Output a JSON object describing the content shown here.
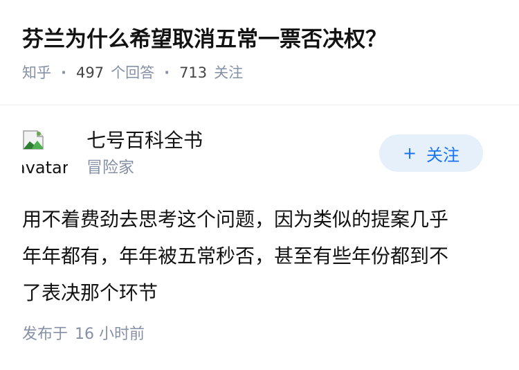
{
  "question": {
    "title": "芬兰为什么希望取消五常一票否决权？",
    "source": "知乎",
    "separator": "·",
    "answer_count": "497",
    "answer_label": "个回答",
    "follower_count": "713",
    "follower_label": "关注"
  },
  "answer": {
    "author": {
      "avatar_alt": "avatar",
      "name": "七号百科全书",
      "badge": "冒险家"
    },
    "follow_button": {
      "icon": "plus-icon",
      "label": "关注"
    },
    "content_lines": [
      "用不着费劲去思考这个问题，因为类似的提案几乎",
      "年年都有，年年被五常秒否，甚至有些年份都到不",
      "了表决那个环节"
    ],
    "published_prefix": "发布于",
    "published_time": "16 小时前"
  },
  "colors": {
    "primary_text": "#121212",
    "secondary_text": "#8590a6",
    "accent": "#1772f6",
    "follow_button_bg": "#e5f0fb",
    "divider": "#eceef2"
  }
}
